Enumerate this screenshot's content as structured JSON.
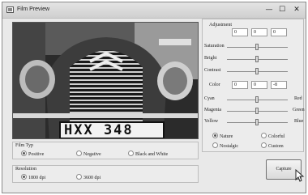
{
  "window": {
    "title": "Film Preview",
    "minimize": "—",
    "maximize": "☐",
    "close": "✕"
  },
  "preview": {
    "plate_text": "HXX 348"
  },
  "adjustment": {
    "title": "Adjustment",
    "values": [
      "0",
      "0",
      "0"
    ],
    "sliders": [
      {
        "label": "Saturation",
        "level": 0.5
      },
      {
        "label": "Bright",
        "level": 0.5
      },
      {
        "label": "Contrast",
        "level": 0.5
      }
    ]
  },
  "color": {
    "label": "Color",
    "values": [
      "0",
      "0",
      "-8"
    ],
    "sliders": [
      {
        "left": "Cyan",
        "right": "Red",
        "level": 0.5
      },
      {
        "left": "Magenta",
        "right": "Green",
        "level": 0.5
      },
      {
        "left": "Yellow",
        "right": "Blue",
        "level": 0.5
      }
    ],
    "presets": [
      {
        "label": "Nature",
        "selected": true
      },
      {
        "label": "Colorful",
        "selected": false
      },
      {
        "label": "Nostalgic",
        "selected": false
      },
      {
        "label": "Custom",
        "selected": false
      }
    ]
  },
  "film_type": {
    "title": "Film Typ",
    "options": [
      {
        "label": "Positive",
        "selected": true
      },
      {
        "label": "Negative",
        "selected": false
      },
      {
        "label": "Black and White",
        "selected": false
      }
    ]
  },
  "resolution": {
    "title": "Resolution",
    "options": [
      {
        "label": "1800 dpi",
        "selected": true
      },
      {
        "label": "3600 dpi",
        "selected": false
      }
    ]
  },
  "capture_label": "Capture"
}
